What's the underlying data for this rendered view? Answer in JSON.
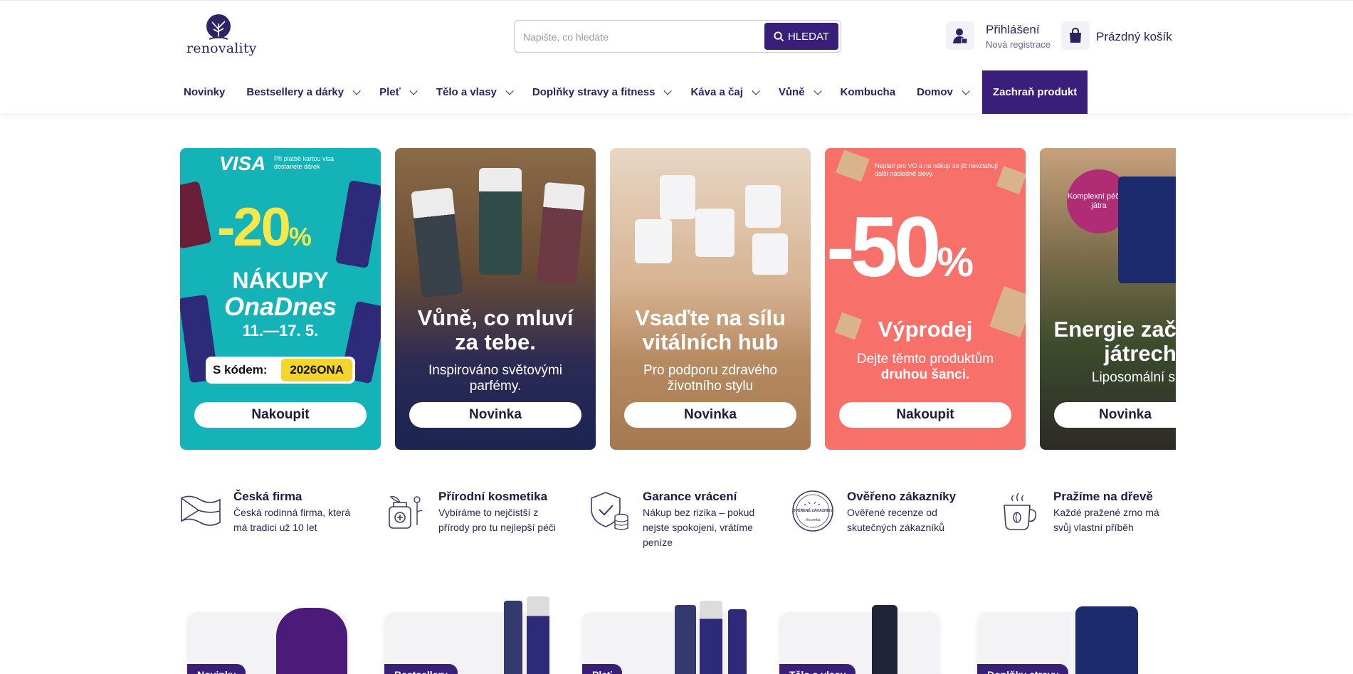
{
  "brand": {
    "name": "renovality",
    "color": "#3a1f7a"
  },
  "search": {
    "placeholder": "Napište, co hledáte",
    "button_label": "HLEDAT"
  },
  "account": {
    "login_label": "Přihlášení",
    "register_label": "Nová registrace",
    "icon": "user-icon"
  },
  "cart": {
    "label": "Prázdný košík",
    "icon": "bag-icon"
  },
  "nav": {
    "items": [
      {
        "label": "Novinky",
        "has_dropdown": false
      },
      {
        "label": "Bestsellery a dárky",
        "has_dropdown": true
      },
      {
        "label": "Pleť",
        "has_dropdown": true
      },
      {
        "label": "Tělo a vlasy",
        "has_dropdown": true
      },
      {
        "label": "Doplňky stravy a fitness",
        "has_dropdown": true
      },
      {
        "label": "Káva a čaj",
        "has_dropdown": true
      },
      {
        "label": "Vůně",
        "has_dropdown": true
      },
      {
        "label": "Kombucha",
        "has_dropdown": false
      },
      {
        "label": "Domov",
        "has_dropdown": true
      }
    ],
    "cta_label": "Zachraň produkt"
  },
  "banners": [
    {
      "visa": "VISA",
      "visa_note": "Při platbě kartou visa dostanete dárek",
      "discount": "-20",
      "percent": "%",
      "line1": "NÁKUPY",
      "line2": "OnaDnes",
      "dates": "11.—17. 5.",
      "code_label": "S kódem:",
      "code": "2026ONA",
      "button": "Nakoupit"
    },
    {
      "title": "Vůně, co mluví za tebe.",
      "subtitle": "Inspirováno světovými parfémy.",
      "button": "Novinka"
    },
    {
      "title": "Vsaďte na sílu vitálních hub",
      "subtitle": "Pro podporu zdravého životního stylu",
      "button": "Novinka"
    },
    {
      "note": "Neplatí pro VO a na nákup se již nevztahují další následné slevy.",
      "discount": "-50",
      "percent": "%",
      "title": "Výprodej",
      "subtitle_a": "Dejte těmto produktům",
      "subtitle_b": "druhou šanci.",
      "button": "Nakoupit"
    },
    {
      "badge": "Komplexní péče o játra",
      "title": "Energie začíná v játrech",
      "subtitle": "Liposomální síly",
      "button": "Novinka"
    }
  ],
  "features": [
    {
      "icon": "czech-flag-icon",
      "title": "Česká firma",
      "desc": "Česká rodinná firma, která má tradici už 10 let"
    },
    {
      "icon": "natural-cosmetics-icon",
      "title": "Přírodní kosmetika",
      "desc": "Vybíráme to nejčistší z přírody pro tu nejlepší péči"
    },
    {
      "icon": "shield-coins-icon",
      "title": "Garance vrácení",
      "desc": "Nákup bez rizika – pokud nejste spokojeni, vrátíme peníze"
    },
    {
      "icon": "verified-badge-icon",
      "title": "Ověřeno zákazníky",
      "desc": "Ověřené recenze od skutečných zákazníků",
      "badge_text": "OVĚŘENÉ ZÁKAZNÍKY",
      "badge_brand": "Heureka"
    },
    {
      "icon": "coffee-cup-icon",
      "title": "Pražíme na dřevě",
      "desc": "Každé pražené zrno má svůj vlastní příběh"
    }
  ],
  "product_cards": [
    {
      "label": "Novinky"
    },
    {
      "label": "Bestsellery"
    },
    {
      "label": "Pleť"
    },
    {
      "label": "Tělo a vlasy"
    },
    {
      "label": "Doplňky stravy"
    }
  ]
}
